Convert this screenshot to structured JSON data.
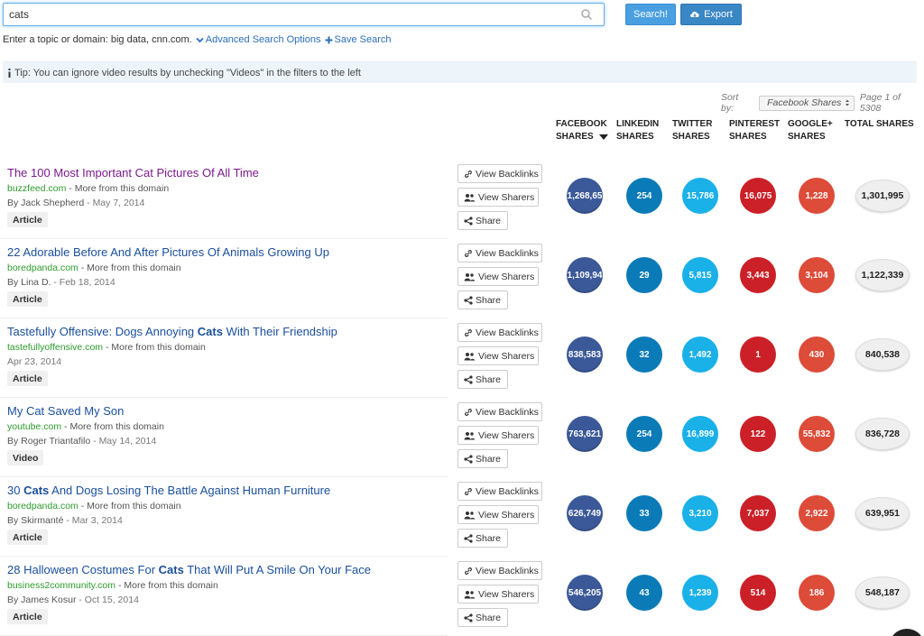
{
  "search": {
    "value": "cats",
    "search_label": "Search!",
    "export_label": "Export"
  },
  "hint": {
    "text": "Enter a topic or domain: big data, cnn.com.",
    "advanced_label": "Advanced Search Options",
    "save_label": "Save Search"
  },
  "tip": {
    "text": "Tip: You can ignore video results by unchecking \"Videos\" in the filters to the left"
  },
  "sort": {
    "label": "Sort by:",
    "selected": "Facebook Shares",
    "page_text": "Page 1 of 5308"
  },
  "columns": {
    "facebook": [
      "FACEBOOK",
      "SHARES"
    ],
    "linkedin": [
      "LINKEDIN",
      "SHARES"
    ],
    "twitter": [
      "TWITTER",
      "SHARES"
    ],
    "pinterest": [
      "PINTEREST",
      "SHARES"
    ],
    "googleplus": [
      "GOOGLE+",
      "SHARES"
    ],
    "total": [
      "TOTAL SHARES"
    ]
  },
  "actions": {
    "backlinks": "View Backlinks",
    "sharers": "View Sharers",
    "share": "Share"
  },
  "more_text": "More from this domain",
  "results": [
    {
      "title_parts": [
        {
          "t": "The 100 Most Important Cat Pictures Of All Time",
          "b": false
        }
      ],
      "visited": true,
      "domain": "buzzfeed.com",
      "author": "By Jack Shepherd",
      "date": "May 7, 2014",
      "type": "Article",
      "facebook": "1,268,65",
      "linkedin": "254",
      "twitter": "15,786",
      "pinterest": "16,075",
      "googleplus": "1,228",
      "total": "1,301,995"
    },
    {
      "title_parts": [
        {
          "t": "22 Adorable Before And After Pictures Of Animals Growing Up",
          "b": false
        }
      ],
      "visited": false,
      "domain": "boredpanda.com",
      "author": "By Lina D.",
      "date": "Feb 18, 2014",
      "type": "Article",
      "facebook": "1,109,94",
      "linkedin": "29",
      "twitter": "5,815",
      "pinterest": "3,443",
      "googleplus": "3,104",
      "total": "1,122,339"
    },
    {
      "title_parts": [
        {
          "t": "Tastefully Offensive: Dogs Annoying ",
          "b": false
        },
        {
          "t": "Cats",
          "b": true
        },
        {
          "t": " With Their Friendship",
          "b": false
        }
      ],
      "visited": false,
      "domain": "tastefullyoffensive.com",
      "author": "",
      "date": "Apr 23, 2014",
      "type": "Article",
      "facebook": "838,583",
      "linkedin": "32",
      "twitter": "1,492",
      "pinterest": "1",
      "googleplus": "430",
      "total": "840,538"
    },
    {
      "title_parts": [
        {
          "t": "My Cat Saved My Son",
          "b": false
        }
      ],
      "visited": false,
      "domain": "youtube.com",
      "author": "By Roger Triantafilo",
      "date": "May 14, 2014",
      "type": "Video",
      "facebook": "763,621",
      "linkedin": "254",
      "twitter": "16,899",
      "pinterest": "122",
      "googleplus": "55,832",
      "total": "836,728"
    },
    {
      "title_parts": [
        {
          "t": "30 ",
          "b": false
        },
        {
          "t": "Cats",
          "b": true
        },
        {
          "t": " And Dogs Losing The Battle Against Human Furniture",
          "b": false
        }
      ],
      "visited": false,
      "domain": "boredpanda.com",
      "author": "By Skirmanté",
      "date": "Mar 3, 2014",
      "type": "Article",
      "facebook": "626,749",
      "linkedin": "33",
      "twitter": "3,210",
      "pinterest": "7,037",
      "googleplus": "2,922",
      "total": "639,951"
    },
    {
      "title_parts": [
        {
          "t": "28 Halloween Costumes For ",
          "b": false
        },
        {
          "t": "Cats",
          "b": true
        },
        {
          "t": " That Will Put A Smile On Your Face",
          "b": false
        }
      ],
      "visited": false,
      "domain": "business2community.com",
      "author": "By James Kosur",
      "date": "Oct 15, 2014",
      "type": "Article",
      "facebook": "546,205",
      "linkedin": "43",
      "twitter": "1,239",
      "pinterest": "514",
      "googleplus": "186",
      "total": "548,187"
    }
  ]
}
